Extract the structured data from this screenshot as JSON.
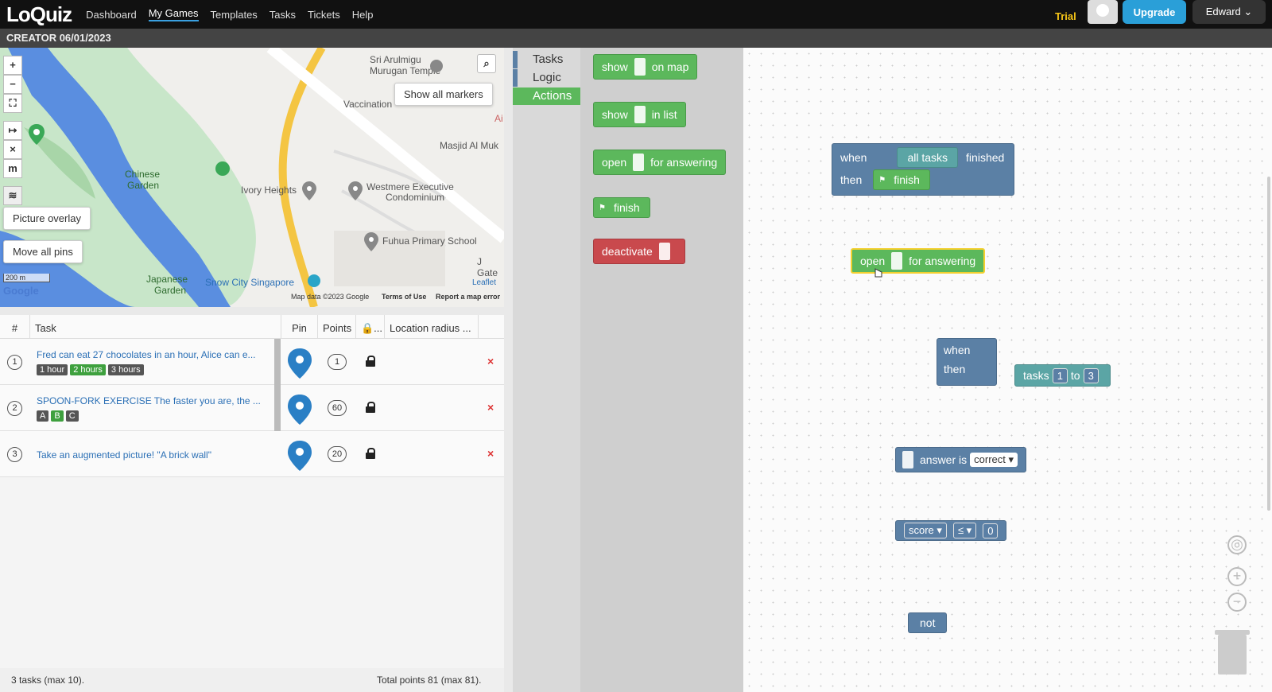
{
  "nav": {
    "logo": "LoQuiz",
    "items": [
      "Dashboard",
      "My Games",
      "Templates",
      "Tasks",
      "Tickets",
      "Help"
    ],
    "trial": "Trial",
    "upgrade": "Upgrade",
    "user": "Edward ⌄"
  },
  "subheader": "CREATOR 06/01/2023",
  "map": {
    "controls": [
      "+",
      "−",
      "⛶",
      "↦",
      "×",
      "m"
    ],
    "show_all_markers": "Show all markers",
    "picture_overlay": "Picture overlay",
    "move_all_pins": "Move all pins",
    "labels": [
      "Sri Arulmigu",
      "Murugan Temple",
      "Vaccination",
      "Masjid Al Muk",
      "Chinese",
      "Garden",
      "Ivory Heights",
      "Westmere Executive",
      "Condominium",
      "Fuhua Primary School",
      "J Gate",
      "Japanese",
      "Garden",
      "Snow City Singapore",
      "Ai"
    ],
    "scale": "200 m",
    "google": "Google",
    "map_data": "Map data ©2023 Google",
    "terms": "Terms of Use",
    "report": "Report a map error",
    "leaflet": "Leaflet",
    "colors": {
      "water": "#5a8ee0",
      "park": "#c8e6c9",
      "road": "#f4c542"
    }
  },
  "table": {
    "headers": [
      "#",
      "Task",
      "Pin",
      "Points",
      "🔒...",
      "Location radius ..."
    ],
    "rows": [
      {
        "num": "1",
        "title": "Fred can eat 27 chocolates in an hour, Alice can e...",
        "tags": [
          "1 hour",
          "2 hours",
          "3 hours"
        ],
        "points": "1"
      },
      {
        "num": "2",
        "title": "SPOON-FORK EXERCISE The faster you are, the ...",
        "tags": [
          "A",
          "B",
          "C"
        ],
        "points": "60"
      },
      {
        "num": "3",
        "title": "Take an augmented picture! \"A brick wall\"",
        "tags": [],
        "points": "20"
      }
    ],
    "footer_left": "3 tasks (max 10).",
    "footer_right": "Total points 81 (max 81)."
  },
  "categories": [
    {
      "label": "Tasks",
      "color": "#5b80a5"
    },
    {
      "label": "Logic",
      "color": "#5b80a5"
    },
    {
      "label": "Actions",
      "color": "#5cb85c"
    }
  ],
  "palette": {
    "show_on_map": [
      "show",
      "on map"
    ],
    "show_in_list": [
      "show",
      "in list"
    ],
    "open_for_answering": [
      "open",
      "for answering"
    ],
    "finish": "finish",
    "deactivate": "deactivate"
  },
  "workspace": {
    "event": {
      "when": "when",
      "all_tasks": "all tasks",
      "finished": "finished",
      "then": "then",
      "finish": "finish"
    },
    "open_block": [
      "open",
      "for answering"
    ],
    "event2": {
      "when": "when",
      "then": "then"
    },
    "tasks": {
      "label": "tasks",
      "from": "1",
      "to": "to",
      "end": "3"
    },
    "answer": {
      "label": "answer is",
      "value": "correct ▾"
    },
    "score": {
      "label": "score ▾",
      "op": "≤ ▾",
      "value": "0"
    },
    "not": "not"
  }
}
